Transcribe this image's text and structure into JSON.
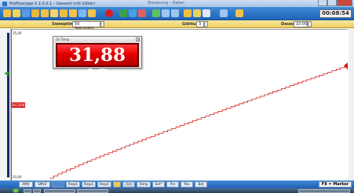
{
  "window": {
    "title": "Profiloscope V 2.0.0.1 – Gesamt (mit Gitter)",
    "title2": "Steuerung – Daten"
  },
  "toolbar": {
    "clock": "00:08:54"
  },
  "params": {
    "sweep_label": "Sweeptime:",
    "sweep_value": "50 Sekunden",
    "smoothing_label": "Glättung",
    "smoothing_value": "3",
    "duration_label": "Dauer:",
    "duration_value": "10:00"
  },
  "plot": {
    "y_top": "35,00",
    "y_bottom": "20,64",
    "cursor_label": "28,5568"
  },
  "temp_widget": {
    "title": "Oil Temp",
    "value": "31,88 °C"
  },
  "channels": [
    "AMV",
    "SMV2",
    "",
    "Resp1",
    "Resp1",
    "Resp1",
    "",
    "Sat",
    "Temp",
    "Ext*",
    "Pre",
    "Pos",
    "Bat"
  ],
  "bottom": {
    "f8": "F8 = Marker"
  },
  "colors": {
    "toolbar_blue": "#2f78cc",
    "param_yellow": "#f1d774",
    "trace_red": "#d01818",
    "display_red": "#e50000"
  }
}
